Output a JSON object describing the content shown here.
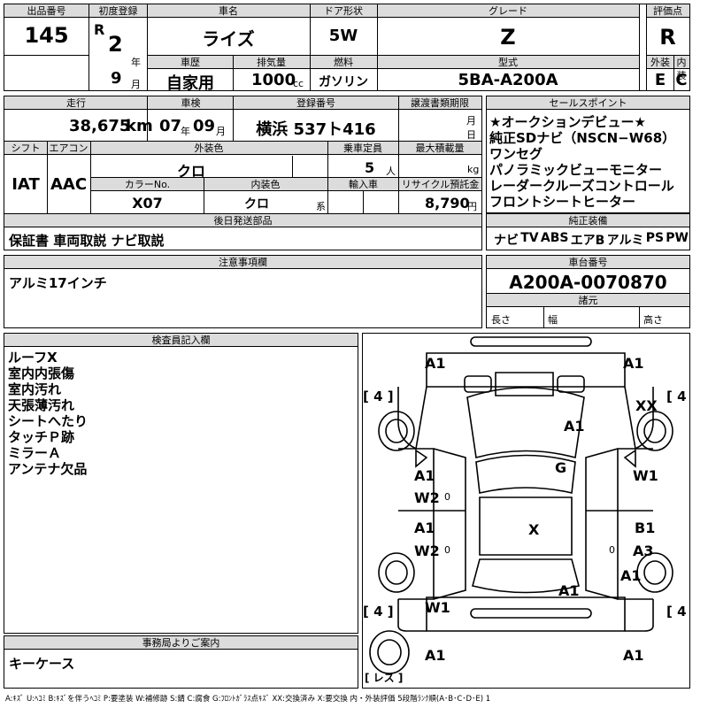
{
  "top": {
    "lot_label": "出品番号",
    "lot": "145",
    "first_reg_label": "初度登録",
    "era": "R",
    "year": "2",
    "year_unit": "年",
    "month": "9",
    "month_unit": "月",
    "car_name_label": "車名",
    "car_name": "ライズ",
    "door_label": "ドア形状",
    "door": "5W",
    "grade_label": "グレード",
    "grade": "Z",
    "score_label": "評価点",
    "score": "R",
    "history_label": "車歴",
    "history": "自家用",
    "displacement_label": "排気量",
    "displacement": "1000",
    "displacement_unit": "cc",
    "fuel_label": "燃料",
    "fuel": "ガソリン",
    "model_label": "型式",
    "model": "5BA-A200A",
    "ext_label": "外装",
    "ext": "E",
    "int_label": "内装",
    "int": "C"
  },
  "second": {
    "mileage_label": "走行",
    "mileage": "38,675",
    "mileage_unit": "km",
    "inspection_label": "車検",
    "insp_year": "07",
    "insp_year_unit": "年",
    "insp_month": "09",
    "insp_month_unit": "月",
    "reg_label": "登録番号",
    "reg_no": "横浜 537ト416",
    "transfer_label": "譲渡書類期限",
    "transfer_month": "月",
    "transfer_day": "日",
    "sales_label": "セールスポイント",
    "sales_points": [
      "★オークションデビュー★",
      "純正SDナビ（NSCN−W68）",
      "ワンセグ",
      "パノラミックビューモニター",
      "レーダークルーズコントロール",
      "フロントシートヒーター"
    ]
  },
  "third": {
    "shift_label": "シフト",
    "shift": "IAT",
    "ac_label": "エアコン",
    "ac": "AAC",
    "ext_color_label": "外装色",
    "ext_color": "クロ",
    "capacity_label": "乗車定員",
    "capacity": "5",
    "capacity_unit": "人",
    "load_label": "最大積載量",
    "load_unit": "kg",
    "color_no_label": "カラーNo.",
    "color_no": "X07",
    "int_color_label": "内装色",
    "int_color": "クロ",
    "int_color_unit": "系",
    "import_label": "輸入車",
    "recycle_label": "リサイクル預託金",
    "recycle": "8,790",
    "recycle_unit": "円"
  },
  "docs": {
    "label": "後日発送部品",
    "value": "保証書 車両取説 ナビ取説"
  },
  "equip": {
    "label": "純正装備",
    "items": [
      "ナビ",
      "TV",
      "ABS",
      "エアB",
      "アルミ",
      "PS",
      "PW"
    ]
  },
  "notes": {
    "label": "注意事項欄",
    "value": "アルミ17インチ"
  },
  "chassis": {
    "label": "車台番号",
    "value": "A200A-0070870",
    "spec_label": "諸元",
    "length": "長さ",
    "width": "幅",
    "height": "高さ"
  },
  "inspector": {
    "label": "検査員記入欄",
    "items": [
      "ルーフX",
      "室内内張傷",
      "室内汚れ",
      "天張薄汚れ",
      "シートへたり",
      "タッチＰ跡",
      "ミラーＡ",
      "アンテナ欠品"
    ]
  },
  "office": {
    "label": "事務局よりご案内",
    "value": "キーケース"
  },
  "diagram": {
    "marks": {
      "tl": "A1",
      "tr": "A1",
      "fr": "XX",
      "hood": "A1",
      "roof_g": "G",
      "lf1": "A1",
      "lf2": "W2",
      "rf1": "W1",
      "lr1": "A1",
      "lr2": "W2",
      "rr1": "B1",
      "rr2": "A3",
      "center": "X",
      "trunk": "A1",
      "rside": "A1",
      "lbot": "W1",
      "bl": "A1",
      "br": "A1"
    },
    "tire_tl": "4",
    "tire_tr": "4",
    "tire_bl": "4",
    "tire_br": "4",
    "spare": "レス",
    "zero": "0"
  },
  "footer": "A:ｷｽﾞ U:ﾍｺﾐ B:ｷｽﾞを伴うﾍｺﾐ P:要塗装 W:補修跡 S:錆 C:腐食 G:ﾌﾛﾝﾄｶﾞﾗｽ点ｷｽﾞ XX:交換済み X:要交換 内・外装評価 5段階ﾗﾝｸ順(A･B･C･D･E) 1"
}
